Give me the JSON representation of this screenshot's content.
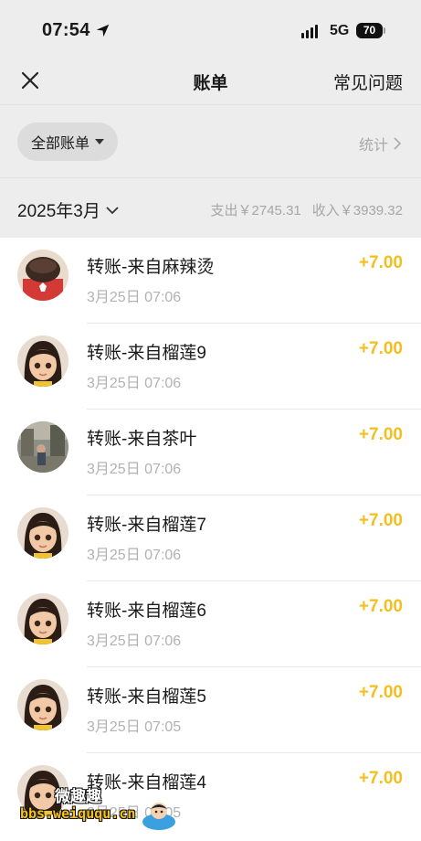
{
  "status_bar": {
    "time": "07:54",
    "network": "5G",
    "battery": "70"
  },
  "nav": {
    "title": "账单",
    "right": "常见问题",
    "close_icon": "close-icon"
  },
  "filter": {
    "label": "全部账单",
    "stats": "统计"
  },
  "month": {
    "label": "2025年3月",
    "expense": "支出￥2745.31",
    "income": "收入￥3939.32"
  },
  "transactions": [
    {
      "title": "转账-来自麻辣烫",
      "date": "3月25日 07:06",
      "amount": "+7.00",
      "avatar": "drink-cup"
    },
    {
      "title": "转账-来自榴莲9",
      "date": "3月25日 07:06",
      "amount": "+7.00",
      "avatar": "cartoon-girl"
    },
    {
      "title": "转账-来自茶叶",
      "date": "3月25日 07:06",
      "amount": "+7.00",
      "avatar": "street-photo"
    },
    {
      "title": "转账-来自榴莲7",
      "date": "3月25日 07:06",
      "amount": "+7.00",
      "avatar": "cartoon-girl"
    },
    {
      "title": "转账-来自榴莲6",
      "date": "3月25日 07:06",
      "amount": "+7.00",
      "avatar": "cartoon-girl"
    },
    {
      "title": "转账-来自榴莲5",
      "date": "3月25日 07:05",
      "amount": "+7.00",
      "avatar": "cartoon-girl"
    },
    {
      "title": "转账-来自榴莲4",
      "date": "3月25日 07:05",
      "amount": "+7.00",
      "avatar": "cartoon-girl"
    }
  ],
  "watermark": {
    "line1": "微趣趣",
    "line2": "bbs.weiququ.cn"
  },
  "colors": {
    "amount": "#f2bf1f",
    "header_bg": "#ededed"
  }
}
